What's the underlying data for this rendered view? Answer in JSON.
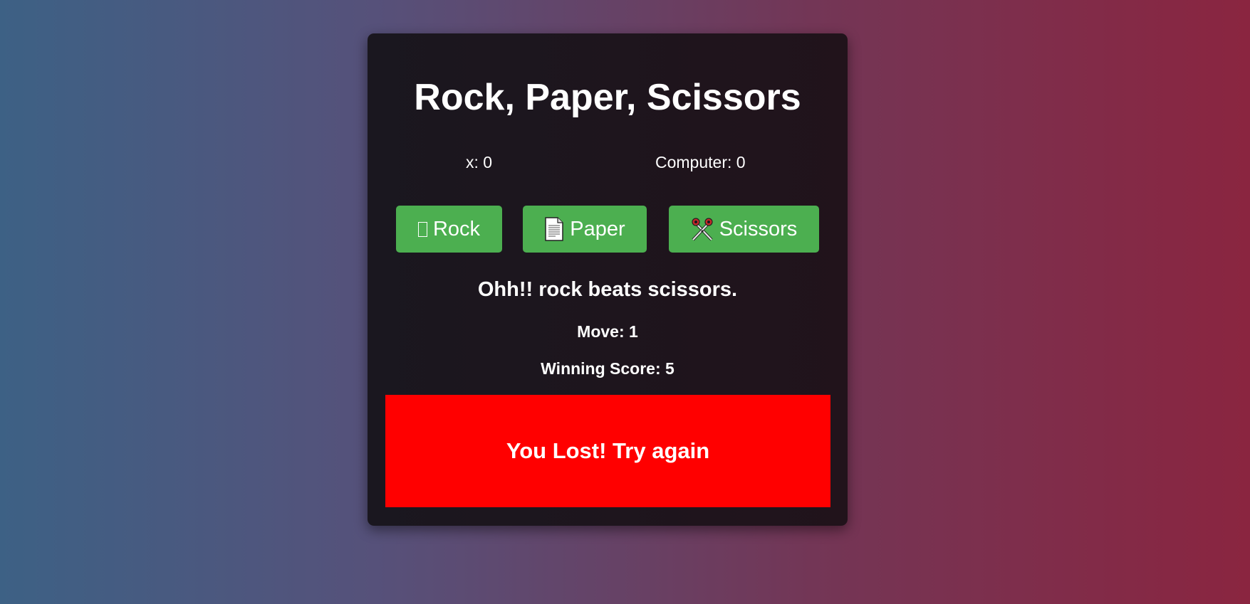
{
  "game": {
    "title": "Rock, Paper, Scissors",
    "player_score": "x: 0",
    "computer_score": "Computer: 0",
    "buttons": [
      {
        "label": "Rock",
        "icon": "missing-glyph-icon"
      },
      {
        "label": "Paper",
        "icon": "page-icon"
      },
      {
        "label": "Scissors",
        "icon": "scissors-icon"
      }
    ],
    "result_text": "Ohh!! rock beats scissors.",
    "move_text": "Move: 1",
    "winning_score_text": "Winning Score: 5",
    "banner_text": "You Lost! Try again"
  },
  "colors": {
    "button_bg": "#4caf50",
    "banner_bg": "#ff0000",
    "card_bg": "#1c161e",
    "gradient_left": "#3d6185",
    "gradient_right": "#8a2540"
  }
}
